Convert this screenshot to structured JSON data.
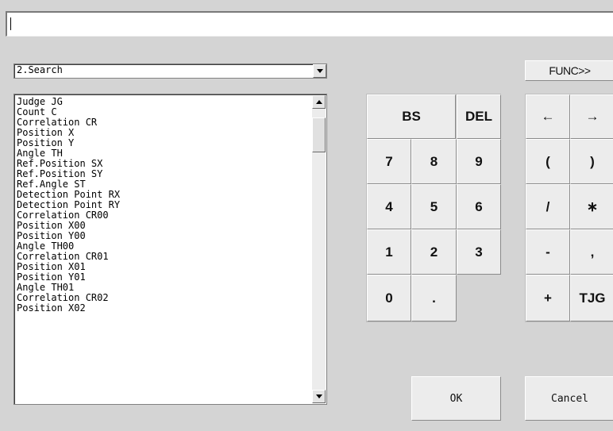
{
  "expression": {
    "value": ""
  },
  "category": {
    "selected": "2.Search"
  },
  "variables": [
    "Judge JG",
    "Count C",
    "Correlation CR",
    "Position X",
    "Position Y",
    "Angle TH",
    "Ref.Position SX",
    "Ref.Position SY",
    "Ref.Angle ST",
    "Detection Point RX",
    "Detection Point RY",
    "Correlation CR00",
    "Position X00",
    "Position Y00",
    "Angle TH00",
    "Correlation CR01",
    "Position X01",
    "Position Y01",
    "Angle TH01",
    "Correlation CR02",
    "Position X02"
  ],
  "keypad": {
    "bs": "BS",
    "del": "DEL",
    "k7": "7",
    "k8": "8",
    "k9": "9",
    "k4": "4",
    "k5": "5",
    "k6": "6",
    "k1": "1",
    "k2": "2",
    "k3": "3",
    "k0": "0",
    "dot": "."
  },
  "func_pad": {
    "toggle_label": "FUNC>>",
    "left": "←",
    "right": "→",
    "lparen": "(",
    "rparen": ")",
    "slash": "/",
    "asterisk": "∗",
    "minus": "-",
    "comma": ",",
    "plus": "+",
    "tjg": "TJG"
  },
  "buttons": {
    "ok": "OK",
    "cancel": "Cancel"
  },
  "icons": {
    "dropdown": "chevron-down-icon",
    "scroll_up": "arrow-up-icon",
    "scroll_down": "arrow-down-icon"
  }
}
